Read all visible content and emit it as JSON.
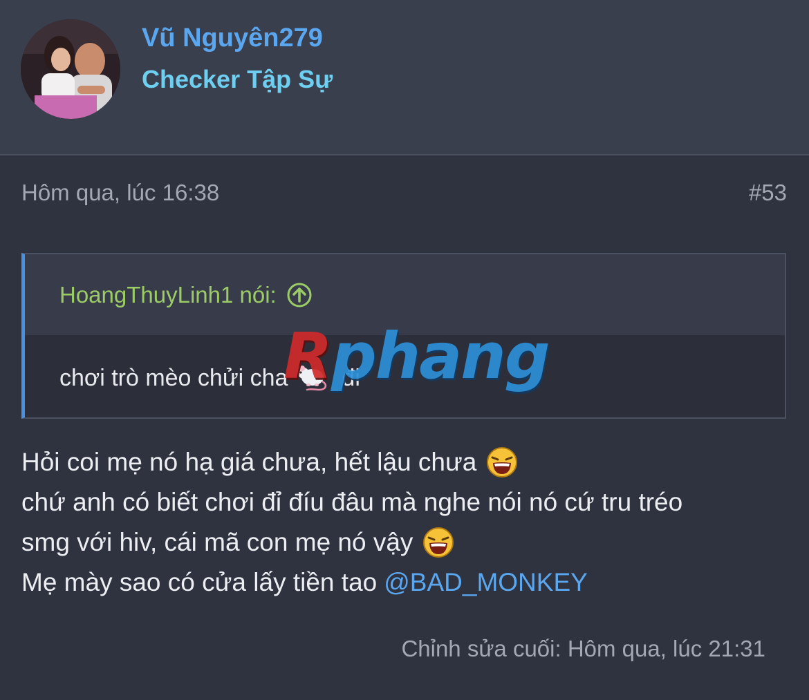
{
  "user": {
    "name": "Vũ Nguyên279",
    "title": "Checker Tập Sự"
  },
  "post": {
    "date": "Hôm qua, lúc 16:38",
    "number": "#53",
    "quote": {
      "author": "HoangThuyLinh1 nói:",
      "text_before": "chơi trò mèo chửi cha",
      "text_after": "đi",
      "emoji_icon": "rat-icon"
    },
    "lines": [
      "Hỏi coi mẹ nó hạ giá chưa, hết lậu chưa",
      "chứ anh có biết chơi đỉ đíu đâu mà nghe nói nó cứ tru tréo",
      "smg với hiv, cái mã con mẹ nó vậy",
      "Mẹ mày sao có cửa lấy tiền tao"
    ],
    "mention": "@BAD_MONKEY",
    "edited": "Chỉnh sửa cuối: Hôm qua, lúc 21:31"
  },
  "watermark": {
    "first": "R",
    "rest": "phang"
  },
  "colors": {
    "accent": "#5aa7f0",
    "quote_author": "#9ccc65",
    "quote_border": "#4a90e2",
    "background": "#2f333f"
  }
}
